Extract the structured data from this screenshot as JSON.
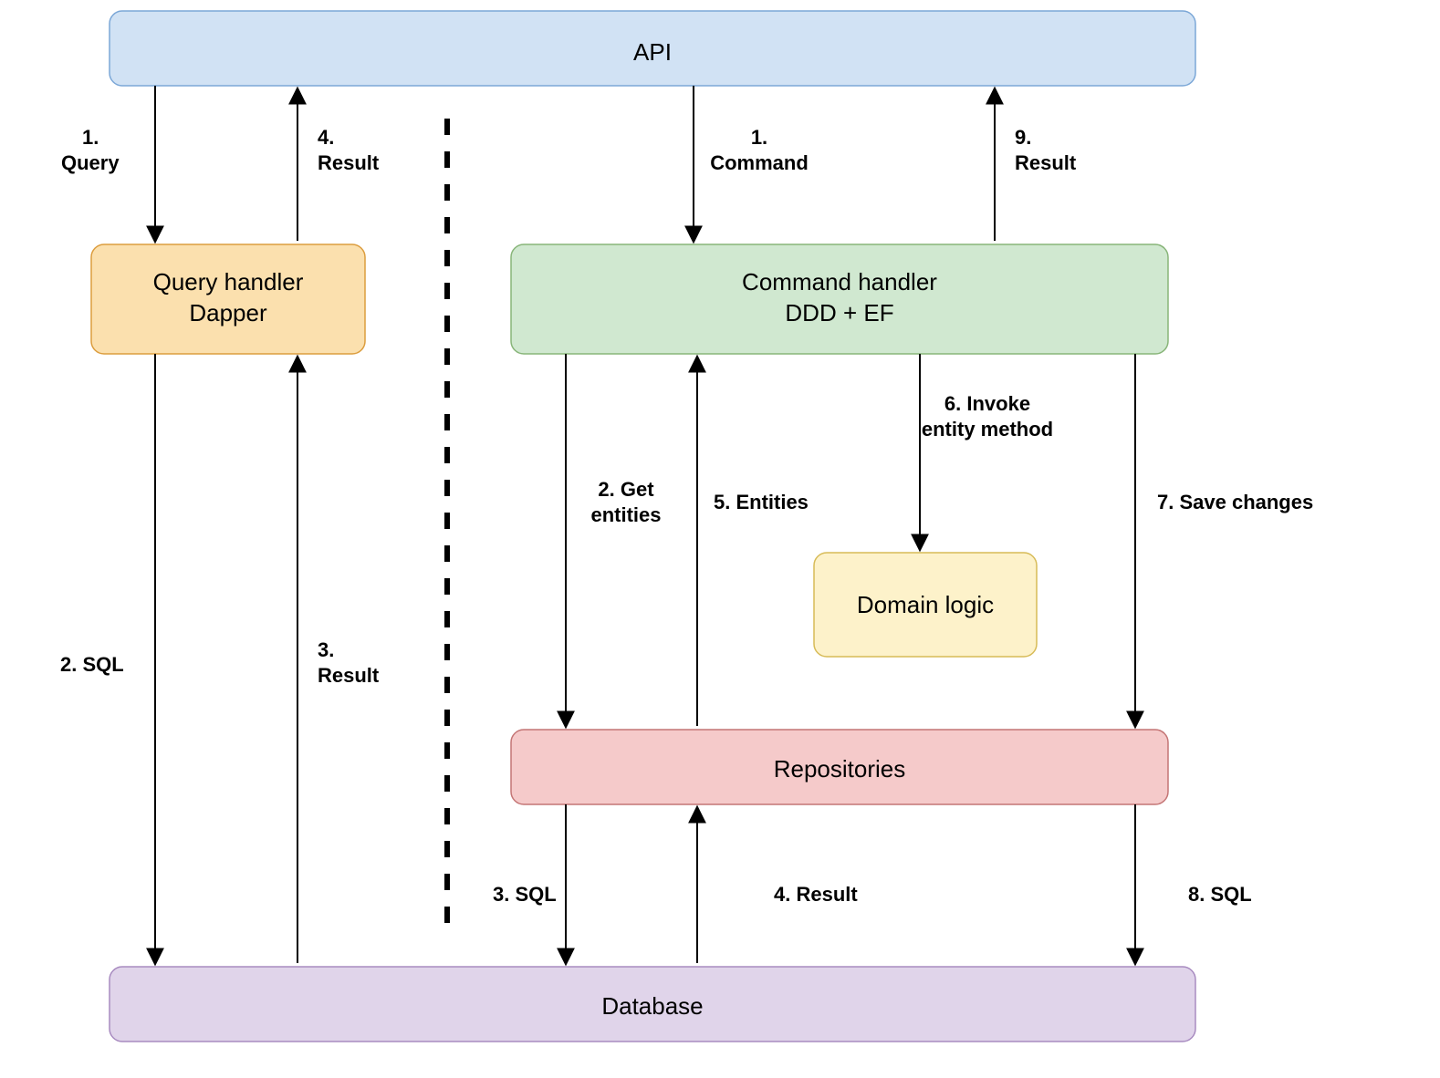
{
  "boxes": {
    "api": "API",
    "queryHandler": {
      "line1": "Query handler",
      "line2": "Dapper"
    },
    "commandHandler": {
      "line1": "Command handler",
      "line2": "DDD + EF"
    },
    "domainLogic": "Domain logic",
    "repositories": "Repositories",
    "database": "Database"
  },
  "labels": {
    "l1q": {
      "a": "1.",
      "b": "Query"
    },
    "l4r": {
      "a": "4.",
      "b": "Result"
    },
    "l2s": "2. SQL",
    "l3r": {
      "a": "3.",
      "b": "Result"
    },
    "l1c": {
      "a": "1.",
      "b": "Command"
    },
    "l9r": {
      "a": "9.",
      "b": "Result"
    },
    "l2g": {
      "a": "2. Get",
      "b": "entities"
    },
    "l5e": "5. Entities",
    "l6i": {
      "a": "6. Invoke",
      "b": "entity method"
    },
    "l7s": "7. Save changes",
    "l3s": "3. SQL",
    "l4res": "4. Result",
    "l8s": "8. SQL"
  }
}
